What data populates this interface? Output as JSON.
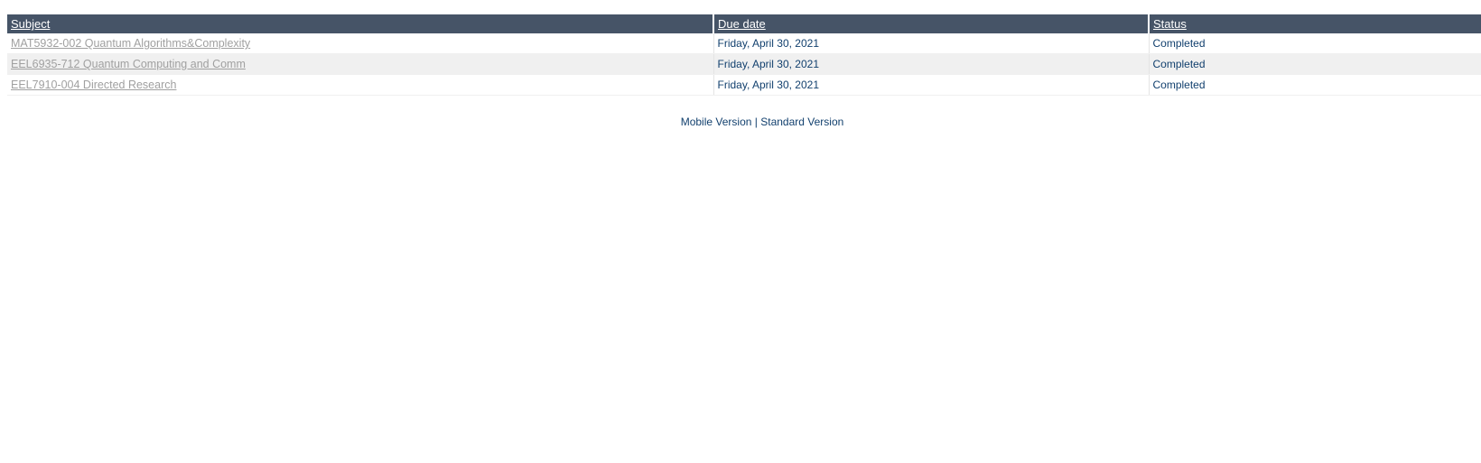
{
  "table": {
    "headers": {
      "subject": "Subject",
      "due_date": "Due date",
      "status": "Status"
    },
    "rows": [
      {
        "subject": "MAT5932-002 Quantum Algorithms&Complexity",
        "due_date": "Friday, April 30, 2021",
        "status": "Completed"
      },
      {
        "subject": "EEL6935-712 Quantum Computing and Comm",
        "due_date": "Friday, April 30, 2021",
        "status": "Completed"
      },
      {
        "subject": "EEL7910-004 Directed Research",
        "due_date": "Friday, April 30, 2021",
        "status": "Completed"
      }
    ]
  },
  "footer": {
    "mobile_label": "Mobile Version",
    "separator": "|",
    "standard_label": "Standard Version"
  },
  "colors": {
    "header_bg": "#465467",
    "header_text": "#ffffff",
    "link_disabled": "#a0a0a0",
    "body_text": "#12406e",
    "alt_row_bg": "#f0f0f0"
  }
}
